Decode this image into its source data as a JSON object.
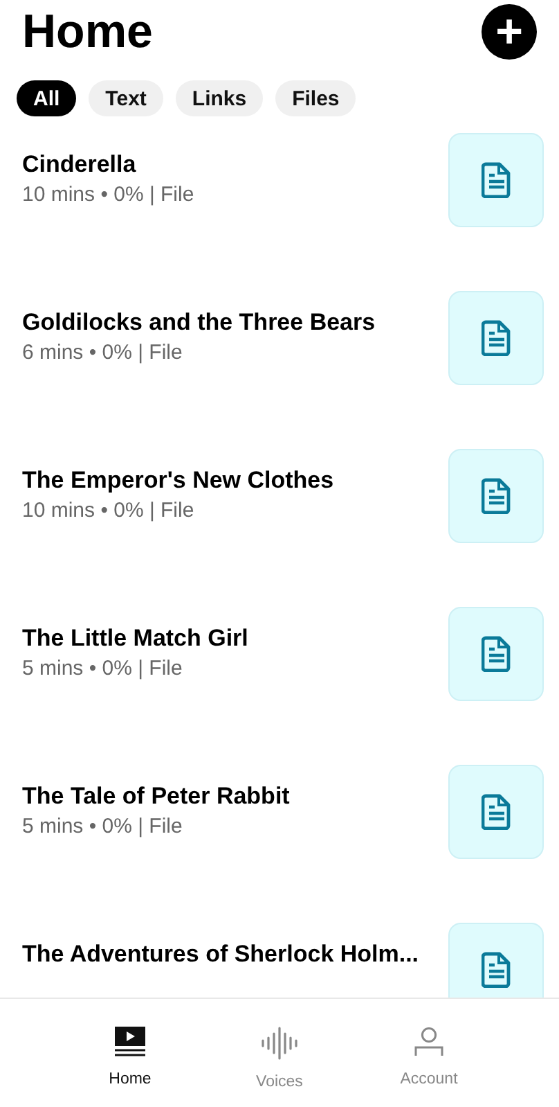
{
  "header": {
    "title": "Home",
    "add_button": "+"
  },
  "filters": [
    {
      "label": "All",
      "selected": true
    },
    {
      "label": "Text",
      "selected": false
    },
    {
      "label": "Links",
      "selected": false
    },
    {
      "label": "Files",
      "selected": false
    }
  ],
  "items": [
    {
      "title": "Cinderella",
      "meta": "10 mins • 0% | File"
    },
    {
      "title": "Goldilocks and the Three Bears",
      "meta": "6 mins • 0% | File"
    },
    {
      "title": "The Emperor's New Clothes",
      "meta": "10 mins • 0% | File"
    },
    {
      "title": "The Little Match Girl",
      "meta": "5 mins • 0% | File"
    },
    {
      "title": "The Tale of Peter Rabbit",
      "meta": "5 mins • 0% | File"
    },
    {
      "title": "The Adventures of Sherlock Holm..."
    }
  ],
  "bottom_nav": [
    {
      "label": "Home",
      "kind": "home",
      "selected": true
    },
    {
      "label": "Voices",
      "kind": "voices",
      "selected": false
    },
    {
      "label": "Account",
      "kind": "account",
      "selected": false
    }
  ]
}
